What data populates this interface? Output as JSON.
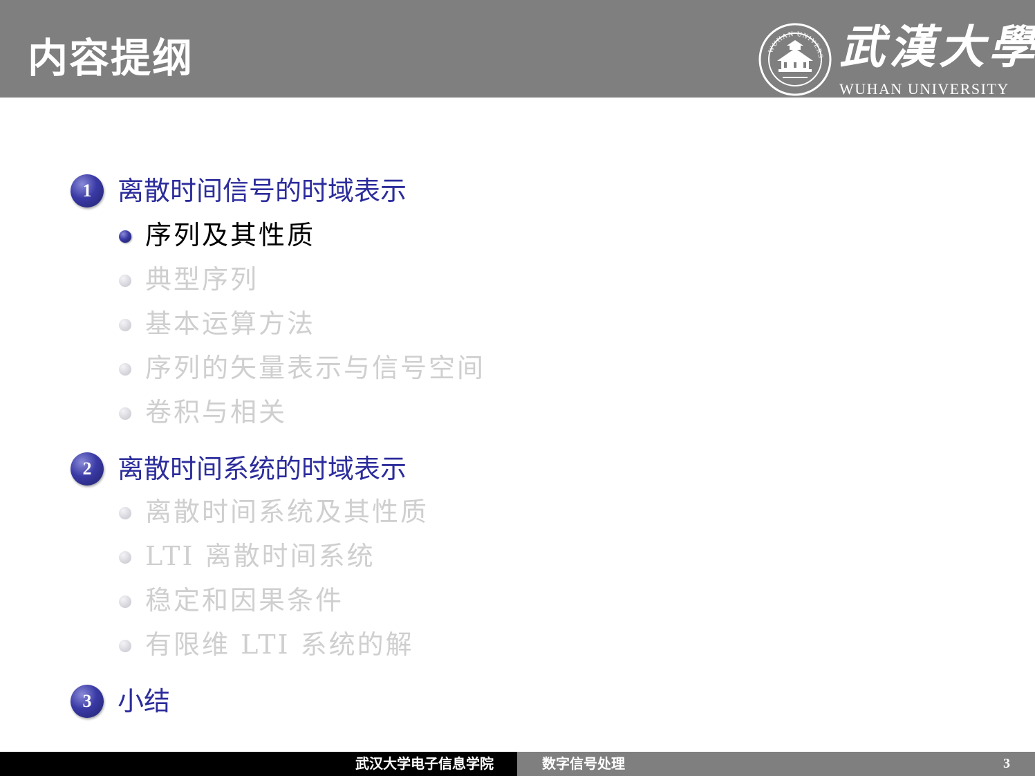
{
  "header": {
    "title": "内容提纲",
    "logo": {
      "cn": "武漢大學",
      "en": "WUHAN UNIVERSITY",
      "seal_text": "WUHAN UNIVERSITY"
    }
  },
  "sections": [
    {
      "number": "1",
      "title": "离散时间信号的时域表示",
      "items": [
        {
          "label": "序列及其性质",
          "state": "active"
        },
        {
          "label": "典型序列",
          "state": "dim"
        },
        {
          "label": "基本运算方法",
          "state": "dim"
        },
        {
          "label": "序列的矢量表示与信号空间",
          "state": "dim"
        },
        {
          "label": "卷积与相关",
          "state": "dim"
        }
      ]
    },
    {
      "number": "2",
      "title": "离散时间系统的时域表示",
      "items": [
        {
          "label": "离散时间系统及其性质",
          "state": "dim"
        },
        {
          "label": "LTI 离散时间系统",
          "state": "dim"
        },
        {
          "label": "稳定和因果条件",
          "state": "dim"
        },
        {
          "label": "有限维 LTI 系统的解",
          "state": "dim"
        }
      ]
    },
    {
      "number": "3",
      "title": "小结",
      "items": []
    }
  ],
  "footer": {
    "institution": "武汉大学电子信息学院",
    "course": "数字信号处理",
    "page": "3"
  },
  "colors": {
    "header_bg": "#7f7f7f",
    "section_title": "#2c2c9c",
    "dim_text": "#cfcfcf",
    "footer_left_bg": "#000000",
    "footer_right_bg": "#7f7f7f"
  }
}
